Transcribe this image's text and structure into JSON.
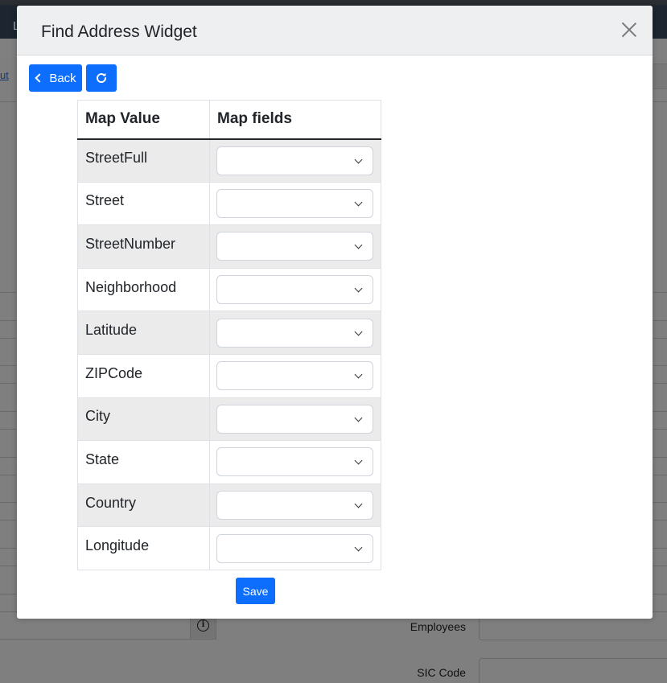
{
  "background": {
    "top_letter": "L",
    "partial_link": "ut",
    "fields": {
      "employees_label": "Employees",
      "sic_code_label": "SIC Code"
    },
    "info_icon": "info-circle-icon"
  },
  "modal": {
    "title": "Find Address Widget",
    "close_icon": "close-icon",
    "toolbar": {
      "back_label": "Back",
      "back_icon": "chevron-left-icon",
      "refresh_icon": "refresh-icon"
    },
    "table": {
      "headers": [
        "Map Value",
        "Map fields"
      ],
      "rows": [
        {
          "value": "StreetFull",
          "field": ""
        },
        {
          "value": "Street",
          "field": ""
        },
        {
          "value": "StreetNumber",
          "field": ""
        },
        {
          "value": "Neighborhood",
          "field": ""
        },
        {
          "value": "Latitude",
          "field": ""
        },
        {
          "value": "ZIPCode",
          "field": ""
        },
        {
          "value": "City",
          "field": ""
        },
        {
          "value": "State",
          "field": ""
        },
        {
          "value": "Country",
          "field": ""
        },
        {
          "value": "Longitude",
          "field": ""
        }
      ]
    },
    "save_label": "Save"
  },
  "colors": {
    "primary": "#0d6efd",
    "overlay": "#808080",
    "striped_row": "#ebebeb",
    "header_bg": "#eeeff1"
  }
}
